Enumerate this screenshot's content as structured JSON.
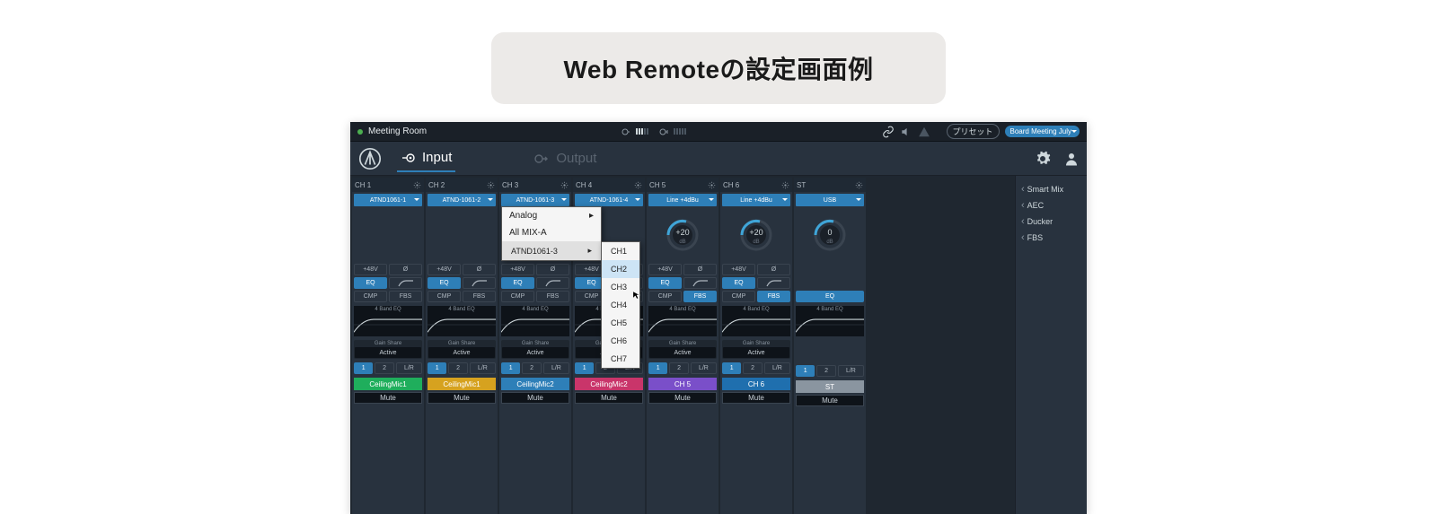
{
  "caption": "Web Remoteの設定画面例",
  "status": {
    "room": "Meeting Room",
    "preset_label": "プリセット",
    "preset_value": "Board Meeting July"
  },
  "nav": {
    "input": "Input",
    "output": "Output"
  },
  "sidebar": {
    "items": [
      "Smart Mix",
      "AEC",
      "Ducker",
      "FBS"
    ]
  },
  "labels": {
    "phantom": "+48V",
    "phase": "Ø",
    "eq": "EQ",
    "hpf": "⌐",
    "cmp": "CMP",
    "fbs": "FBS",
    "band_eq": "4 Band EQ",
    "gain_share": "Gain Share",
    "active": "Active",
    "bus1": "1",
    "bus2": "2",
    "lr": "L/R",
    "mute": "Mute",
    "analog": "Analog",
    "all_mixa": "All MIX-A",
    "atnd_item": "ATND1061-3",
    "sub_ch": [
      "CH1",
      "CH2",
      "CH3",
      "CH4",
      "CH5",
      "CH6",
      "CH7"
    ]
  },
  "channels": [
    {
      "hdr": "CH 1",
      "sel": "ATND1061-1",
      "knob": "",
      "name": "CeilingMic1",
      "color": "#1fae5c",
      "has_proc": true,
      "has_gain": true
    },
    {
      "hdr": "CH 2",
      "sel": "ATND-1061-2",
      "knob": "",
      "name": "CeilingMic1",
      "color": "#d6a21f",
      "has_proc": true,
      "has_gain": true
    },
    {
      "hdr": "CH 3",
      "sel": "ATND-1061-3",
      "knob": "",
      "name": "CeilingMic2",
      "color": "#2e7fb8",
      "has_proc": true,
      "has_gain": true,
      "dropdown": true
    },
    {
      "hdr": "CH 4",
      "sel": "ATND-1061-4",
      "knob": "",
      "name": "CeilingMic2",
      "color": "#c9356a",
      "has_proc": true,
      "has_gain": true
    },
    {
      "hdr": "CH 5",
      "sel": "Line +4dBu",
      "knob": "+20",
      "name": "CH 5",
      "color": "#7a4fc9",
      "has_proc": true,
      "has_gain": true,
      "show_knob": true
    },
    {
      "hdr": "CH 6",
      "sel": "Line +4dBu",
      "knob": "+20",
      "name": "CH 6",
      "color": "#1f6fae",
      "has_proc": true,
      "has_gain": true,
      "show_knob": true
    },
    {
      "hdr": "ST",
      "sel": "USB",
      "knob": "0",
      "name": "ST",
      "color": "#8a95a0",
      "has_proc": false,
      "has_gain": false,
      "show_knob": true,
      "st": true
    }
  ]
}
